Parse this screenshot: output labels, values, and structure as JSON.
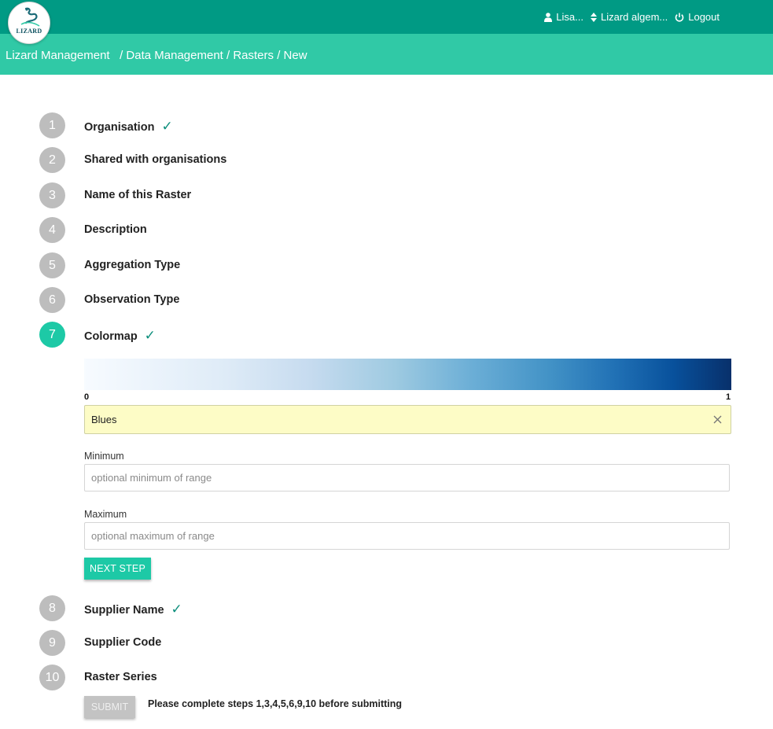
{
  "header": {
    "logo_text": "LIZARD",
    "user": "Lisa...",
    "organisation": "Lizard algem...",
    "logout": "Logout",
    "icons": {
      "user": "user-icon",
      "switch": "sort-icon",
      "logout": "power-icon"
    },
    "colors": {
      "topbar": "#009a84",
      "crumbbar": "#30c9a6"
    }
  },
  "breadcrumb": [
    "Lizard Management",
    "Data Management",
    "Rasters",
    "New"
  ],
  "steps": [
    {
      "number": "1",
      "label": "Organisation",
      "complete": true
    },
    {
      "number": "2",
      "label": "Shared with organisations",
      "complete": false
    },
    {
      "number": "3",
      "label": "Name of this Raster",
      "complete": false
    },
    {
      "number": "4",
      "label": "Description",
      "complete": false
    },
    {
      "number": "5",
      "label": "Aggregation Type",
      "complete": false
    },
    {
      "number": "6",
      "label": "Observation Type",
      "complete": false
    },
    {
      "number": "7",
      "label": "Colormap",
      "complete": true,
      "active": true
    },
    {
      "number": "8",
      "label": "Supplier Name",
      "complete": true
    },
    {
      "number": "9",
      "label": "Supplier Code",
      "complete": false
    },
    {
      "number": "10",
      "label": "Raster Series",
      "complete": false
    }
  ],
  "check_mark": "✓",
  "colormap": {
    "min_tick": "0",
    "max_tick": "1",
    "selected": "Blues",
    "clear_icon": "close-icon",
    "minimum": {
      "label": "Minimum",
      "placeholder": "optional minimum of range",
      "value": ""
    },
    "maximum": {
      "label": "Maximum",
      "placeholder": "optional maximum of range",
      "value": ""
    },
    "next_button": "NEXT STEP",
    "accent": "#1dc9a6"
  },
  "submit": {
    "button": "SUBMIT",
    "message": "Please complete steps 1,3,4,5,6,9,10 before submitting"
  }
}
